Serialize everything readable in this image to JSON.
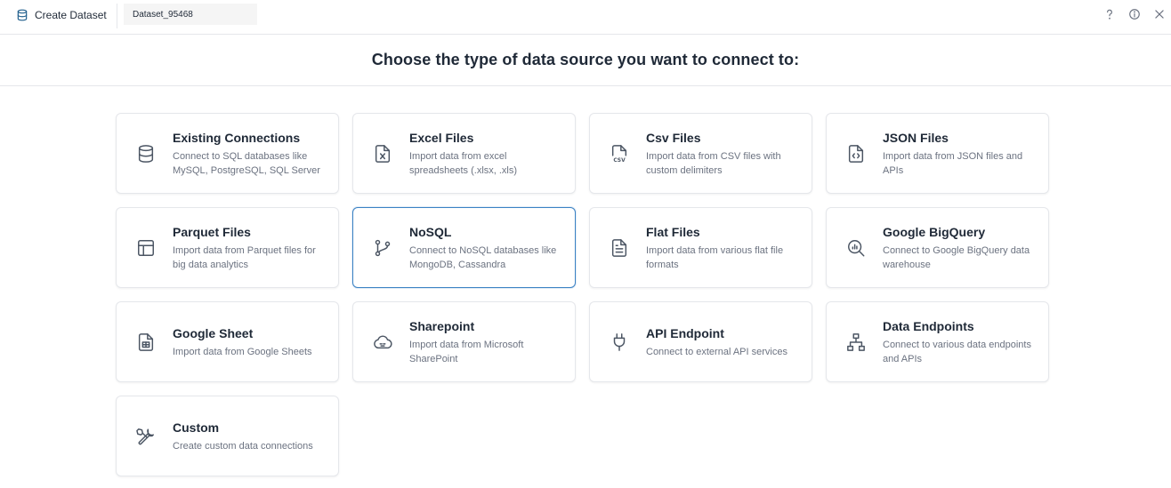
{
  "topbar": {
    "title": "Create Dataset",
    "dataset_name": "Dataset_95468",
    "icons": [
      "database-icon",
      "help-icon",
      "info-icon",
      "close-icon"
    ]
  },
  "heading": "Choose the type of data source you want to connect to:",
  "colors": {
    "accent": "#3b82c4",
    "icon_brand": "#1f5e8c",
    "card_border": "#e5e7eb",
    "text_primary": "#1f2937",
    "text_secondary": "#6b7280"
  },
  "selected_card": "NoSQL",
  "cards": [
    {
      "title": "Existing Connections",
      "desc": "Connect to SQL databases like MySQL, PostgreSQL, SQL Server",
      "icon": "database-icon"
    },
    {
      "title": "Excel Files",
      "desc": "Import data from excel spreadsheets (.xlsx, .xls)",
      "icon": "excel-file-icon"
    },
    {
      "title": "Csv Files",
      "desc": "Import data from CSV files with custom delimiters",
      "icon": "csv-file-icon"
    },
    {
      "title": "JSON Files",
      "desc": "Import data from JSON files and APIs",
      "icon": "json-file-icon"
    },
    {
      "title": "Parquet Files",
      "desc": "Import data from Parquet files for big data analytics",
      "icon": "layout-icon"
    },
    {
      "title": "NoSQL",
      "desc": "Connect to NoSQL databases like MongoDB, Cassandra",
      "icon": "git-branch-icon"
    },
    {
      "title": "Flat Files",
      "desc": "Import data from various flat file formats",
      "icon": "file-text-icon"
    },
    {
      "title": "Google BigQuery",
      "desc": "Connect to Google BigQuery data warehouse",
      "icon": "search-chart-icon"
    },
    {
      "title": "Google Sheet",
      "desc": "Import data from Google Sheets",
      "icon": "sheet-icon"
    },
    {
      "title": "Sharepoint",
      "desc": "Import data from Microsoft SharePoint",
      "icon": "cloud-icon"
    },
    {
      "title": "API Endpoint",
      "desc": "Connect to external API services",
      "icon": "plug-icon"
    },
    {
      "title": "Data Endpoints",
      "desc": "Connect to various data endpoints and APIs",
      "icon": "network-icon"
    },
    {
      "title": "Custom",
      "desc": "Create custom data connections",
      "icon": "tools-icon"
    }
  ]
}
